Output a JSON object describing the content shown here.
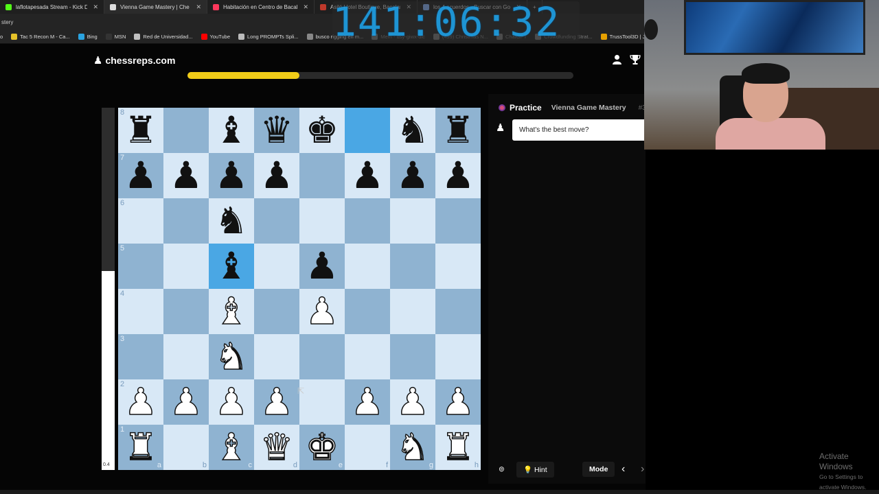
{
  "browser": {
    "tabs": [
      {
        "label": "laflotapesada Stream - Kick Dash",
        "color": "#53fc18",
        "active": false
      },
      {
        "label": "Vienna Game Mastery | Che",
        "color": "#dddddd",
        "active": true
      },
      {
        "label": "Habitación en Centro de Bacalar",
        "color": "#ff385c",
        "active": false
      },
      {
        "label": "Asilé Hotel Boutique, Bacalar, Mé",
        "color": "#c0392b",
        "active": false
      },
      {
        "label": "los 4 acuerdos - Buscar con Goo",
        "color": "#8ab4f8",
        "active": false
      }
    ],
    "address_fragment": "stery",
    "bookmarks": [
      {
        "label": "o",
        "color": "#444444"
      },
      {
        "label": "Tac 5 Recon M - Ca...",
        "color": "#e6c229"
      },
      {
        "label": "Bing",
        "color": "#2aa3e0"
      },
      {
        "label": "MSN",
        "color": "#333333"
      },
      {
        "label": "Red de Universidad...",
        "color": "#c0c0c0"
      },
      {
        "label": "YouTube",
        "color": "#ff0000"
      },
      {
        "label": "Long PROMPTs Spli...",
        "color": "#bbbbbb"
      },
      {
        "label": "busco rigging en m...",
        "color": "#888888"
      },
      {
        "label": "Mem - dsy-giwx-dic",
        "color": "#777777"
      },
      {
        "label": "(499) Christmas N...",
        "color": "#777777"
      },
      {
        "label": "ChatGPT",
        "color": "#777777"
      },
      {
        "label": "Crowdfunding Strat...",
        "color": "#777777"
      },
      {
        "label": "TrussTool3D | JS",
        "color": "#e6a000"
      }
    ]
  },
  "timer": "141:06:32",
  "app": {
    "logo": "chessreps.com",
    "progress_fraction": 0.29,
    "eval": {
      "value": "0.4",
      "white_fraction": 0.55
    },
    "ranks": [
      "8",
      "7",
      "6",
      "5",
      "4",
      "3",
      "2",
      "1"
    ],
    "files": [
      "a",
      "b",
      "c",
      "d",
      "e",
      "f",
      "g",
      "h"
    ],
    "board": [
      [
        "br",
        "",
        "bb",
        "bq",
        "bk",
        "",
        "bn",
        "br"
      ],
      [
        "bp",
        "bp",
        "bp",
        "bp",
        "",
        "bp",
        "bp",
        "bp"
      ],
      [
        "",
        "",
        "bn",
        "",
        "",
        "",
        "",
        ""
      ],
      [
        "",
        "",
        "bb",
        "",
        "bp",
        "",
        "",
        ""
      ],
      [
        "",
        "",
        "wb",
        "",
        "wp",
        "",
        "",
        ""
      ],
      [
        "",
        "",
        "wn",
        "",
        "",
        "",
        "",
        ""
      ],
      [
        "wp",
        "wp",
        "wp",
        "wp",
        "",
        "wp",
        "wp",
        "wp"
      ],
      [
        "wr",
        "",
        "wb",
        "wq",
        "wk",
        "",
        "wn",
        "wr"
      ]
    ],
    "highlighted": [
      [
        0,
        5
      ],
      [
        3,
        2
      ]
    ],
    "panel": {
      "mode": "Practice",
      "course": "Vienna Game Mastery",
      "number": "#3",
      "prompt": "What's the best move?",
      "hint": "Hint",
      "mode_button": "Mode"
    }
  },
  "os": {
    "activate_title": "Activate Windows",
    "activate_sub": "Go to Settings to activate Windows."
  }
}
